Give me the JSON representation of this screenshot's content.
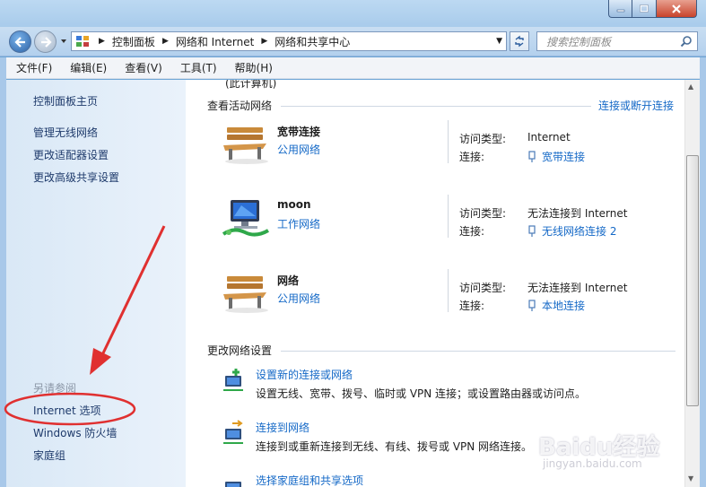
{
  "window": {
    "controls": [
      "minimize",
      "maximize",
      "close"
    ]
  },
  "nav": {
    "breadcrumb": [
      "控制面板",
      "网络和 Internet",
      "网络和共享中心"
    ],
    "search_placeholder": "搜索控制面板"
  },
  "menu": [
    "文件(F)",
    "编辑(E)",
    "查看(V)",
    "工具(T)",
    "帮助(H)"
  ],
  "sidebar": {
    "home": "控制面板主页",
    "links": [
      "管理无线网络",
      "更改适配器设置",
      "更改高级共享设置"
    ],
    "see_also_title": "另请参阅",
    "see_also": [
      "Internet 选项",
      "Windows 防火墙",
      "家庭组"
    ]
  },
  "main": {
    "cutoff_text": "(此计算机)",
    "active_title": "查看活动网络",
    "connect_link": "连接或断开连接",
    "key_access": "访问类型:",
    "key_conn": "连接:",
    "networks": [
      {
        "name": "宽带连接",
        "type": "公用网络",
        "access": "Internet",
        "connection": "宽带连接",
        "icon": "bench-icon"
      },
      {
        "name": "moon",
        "type": "工作网络",
        "access": "无法连接到 Internet",
        "connection": "无线网络连接 2",
        "icon": "computer-icon"
      },
      {
        "name": "网络",
        "type": "公用网络",
        "access": "无法连接到 Internet",
        "connection": "本地连接",
        "icon": "bench-icon"
      }
    ],
    "change_title": "更改网络设置",
    "tasks": [
      {
        "link": "设置新的连接或网络",
        "desc": "设置无线、宽带、拨号、临时或 VPN 连接；或设置路由器或访问点。"
      },
      {
        "link": "连接到网络",
        "desc": "连接到或重新连接到无线、有线、拨号或 VPN 网络连接。"
      },
      {
        "link": "选择家庭组和共享选项",
        "desc": ""
      }
    ]
  },
  "watermark": {
    "brand": "Baidu经验",
    "url": "jingyan.baidu.com"
  },
  "colors": {
    "link": "#1569c7",
    "annotation": "#e03030"
  }
}
